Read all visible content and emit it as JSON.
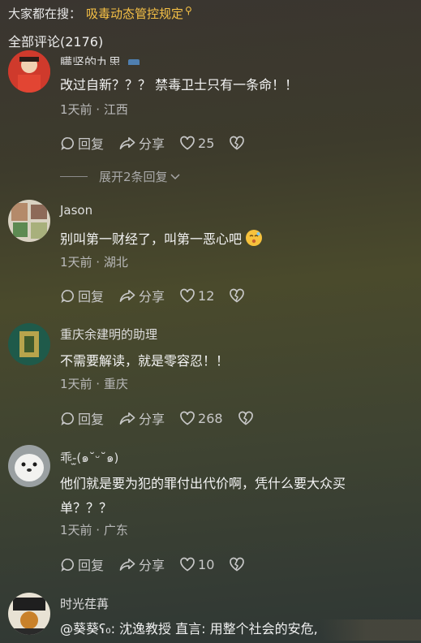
{
  "search": {
    "prefix": "大家都在搜：",
    "term": "吸毒动态管控规定"
  },
  "header": {
    "title": "全部评论(2176)"
  },
  "comments": [
    {
      "username": "瞒坚的九思",
      "content": "改过自新？？？ 禁毒卫士只有一条命！！",
      "meta": "1天前 · 江西",
      "reply_label": "回复",
      "share_label": "分享",
      "likes": "25",
      "expand_label": "展开2条回复"
    },
    {
      "username": "Jason",
      "content": "别叫第一财经了，叫第一恶心吧",
      "meta": "1天前 · 湖北",
      "reply_label": "回复",
      "share_label": "分享",
      "likes": "12"
    },
    {
      "username": "重庆余建明的助理",
      "content": "不需要解读，就是零容忍！！",
      "meta": "1天前 · 重庆",
      "reply_label": "回复",
      "share_label": "分享",
      "likes": "268"
    },
    {
      "username": "乖-̫(๑˘ᵕ˘๑)",
      "content_line1": "他们就是要为犯的罪付出代价啊，凭什么要大众买",
      "content_line2": "单？？？",
      "meta": "1天前 · 广东",
      "reply_label": "回复",
      "share_label": "分享",
      "likes": "10"
    },
    {
      "username": "时光荏苒",
      "content": "@葵葵ʕ₀: 沈逸教授  直言: 用整个社会的安危,"
    }
  ],
  "colors": {
    "accent": "#f5c046",
    "background": "#3f3f2e"
  }
}
